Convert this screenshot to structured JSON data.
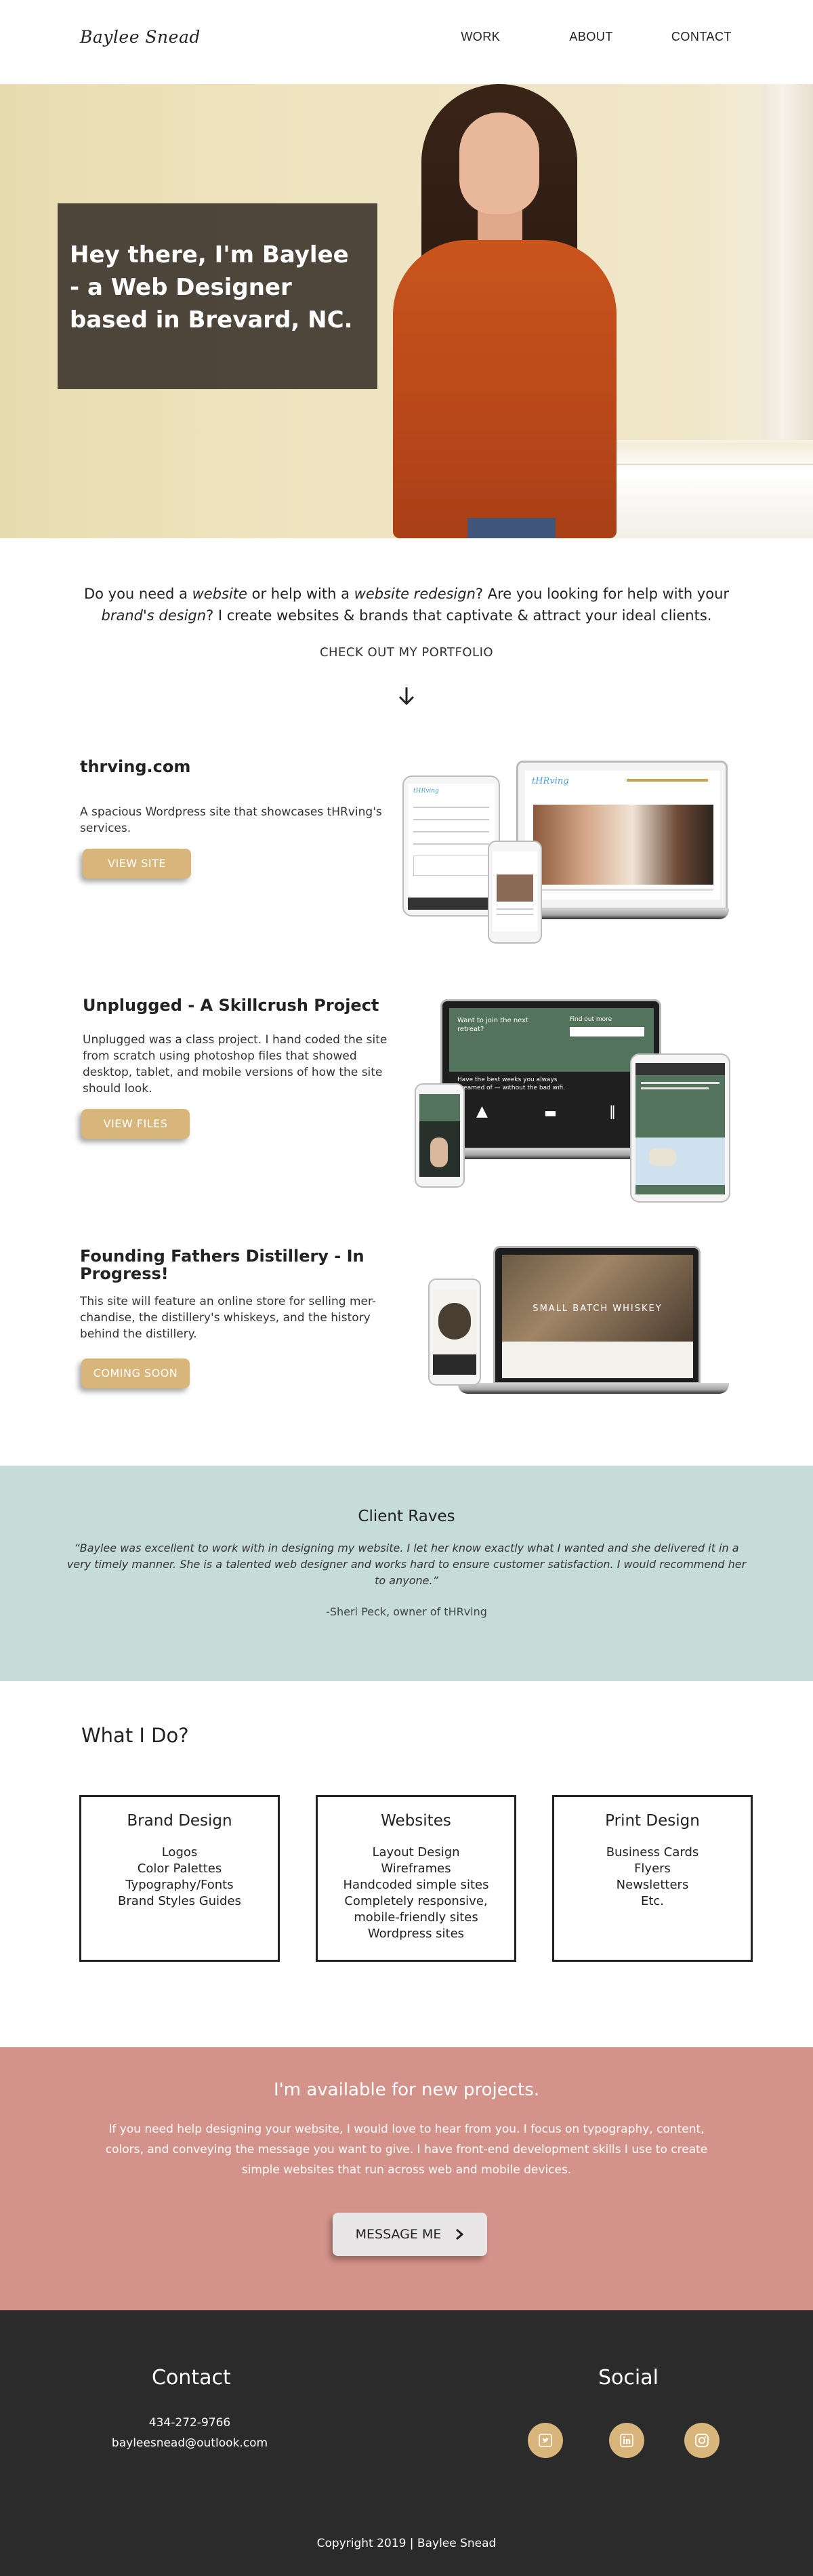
{
  "header": {
    "logo": "Baylee Snead",
    "nav": [
      "WORK",
      "ABOUT",
      "CONTACT"
    ]
  },
  "hero": {
    "headline": "Hey there, I'm Baylee - a Web Designer based in Brevard, NC."
  },
  "intro": {
    "line1_a": "Do you need a ",
    "line1_b": "website",
    "line1_c": " or help with a ",
    "line1_d": "website redesign",
    "line1_e": "? Are you looking for help with your",
    "line2_a": "brand's design",
    "line2_b": "? I create websites & brands that captivate & attract your ideal clients.",
    "portfolio_link": "CHECK OUT MY PORTFOLIO"
  },
  "projects": [
    {
      "title": "thrving.com",
      "description": "A spacious Wordpress site that showcases tHRving's services.",
      "button": "VIEW SITE"
    },
    {
      "title": "Unplugged - A Skillcrush Project",
      "description": "Unplugged was a class project. I hand coded the site from scratch using photoshop files that showed desktop, tablet, and mobile versions of how the site should look.",
      "button": "VIEW FILES"
    },
    {
      "title": "Founding Fathers Distillery - In Progress!",
      "description": "This site will feature an online store for selling mer-chandise, the distillery's whiskeys, and the history behind the distillery.",
      "button": "COMING SOON"
    }
  ],
  "mockups": {
    "thrving_logo": "tHRving",
    "unplugged_heading": "Want to join the next retreat?",
    "unplugged_banner": "Have the best weeks you always dreamed of — without the bad wifi.",
    "unplugged_signup": "Find out more",
    "distillery_heading": "SMALL BATCH WHISKEY"
  },
  "raves": {
    "title": "Client Raves",
    "quote": "“Baylee was excellent to work with in designing my website. I let her know exactly what I wanted and she delivered it in a very timely manner. She is a talented web designer and works hard to ensure customer satisfaction. I would recommend her to anyone.”",
    "author": "-Sheri Peck, owner of tHRving"
  },
  "services": {
    "title": "What I Do?",
    "cards": [
      {
        "title": "Brand Design",
        "items": [
          "Logos",
          "Color Palettes",
          "Typography/Fonts",
          "Brand Styles Guides"
        ]
      },
      {
        "title": "Websites",
        "items": [
          "Layout Design",
          "Wireframes",
          "Handcoded simple sites",
          "Completely responsive,",
          "mobile-friendly sites",
          "Wordpress sites"
        ]
      },
      {
        "title": "Print Design",
        "items": [
          "Business Cards",
          "Flyers",
          "Newsletters",
          "Etc."
        ]
      }
    ]
  },
  "availability": {
    "title": "I'm available for new projects.",
    "text": "If you need help designing your website, I would love to hear from you. I focus on typography, content, colors, and conveying the message you want to give. I have front-end development skills I use to create simple websites that run across web and mobile devices.",
    "button": "MESSAGE ME"
  },
  "footer": {
    "contact_title": "Contact",
    "phone": "434-272-9766",
    "email": "bayleesnead@outlook.com",
    "social_title": "Social",
    "social_icons": [
      "twitter-icon",
      "linkedin-icon",
      "instagram-icon"
    ],
    "copyright": "Copyright 2019 | Baylee Snead"
  },
  "colors": {
    "gold_button": "#d7b57b",
    "teal_section": "#c6dcd8",
    "rose_section": "#d4938a",
    "footer_bg": "#2b2b2b"
  }
}
